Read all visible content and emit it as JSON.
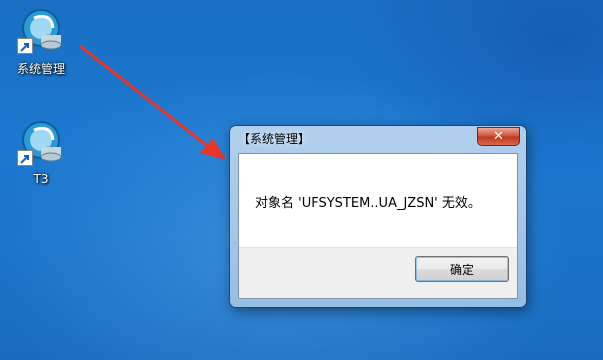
{
  "desktop": {
    "icons": [
      {
        "label": "系统管理"
      },
      {
        "label": "T3"
      }
    ]
  },
  "dialog": {
    "title": "【系统管理】",
    "close_label": "✕",
    "message": "对象名 'UFSYSTEM..UA_JZSN' 无效。",
    "ok_label": "确定"
  },
  "colors": {
    "annotation_arrow": "#e8352a",
    "desktop_background": "#1a6fc4"
  }
}
